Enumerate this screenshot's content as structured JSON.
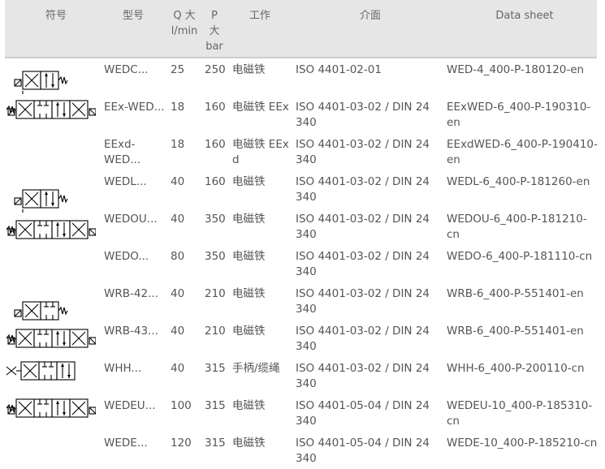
{
  "header": {
    "symbol": "符号",
    "model": "型号",
    "q_max": "Q 大 l/min",
    "p_max": "P 大 bar",
    "operation": "工作",
    "interface": "介面",
    "datasheet": "Data sheet"
  },
  "rows": [
    {
      "model": "WEDC...",
      "q": "25",
      "p": "250",
      "op": "电磁铁",
      "iface": "ISO 4401-02-01",
      "ds": "WED-4_400-P-180120-en",
      "symbol": "valve-3pos-single-solenoid-icon"
    },
    {
      "model": "EEx-WED...",
      "q": "18",
      "p": "160",
      "op": "电磁铁 EEx",
      "iface": "ISO 4401-03-02 / DIN 24 340",
      "ds": "EExWED-6_400-P-190310-en",
      "symbol": "valve-3pos-double-solenoid-icon"
    },
    {
      "model": "EExd-WED...",
      "q": "18",
      "p": "160",
      "op": "电磁铁 EEx d",
      "iface": "ISO 4401-03-02 / DIN 24 340",
      "ds": "EExdWED-6_400-P-190410-en",
      "symbol": ""
    },
    {
      "model": "WEDL...",
      "q": "40",
      "p": "160",
      "op": "电磁铁",
      "iface": "ISO 4401-03-02 / DIN 24 340",
      "ds": "WEDL-6_400-P-181260-en",
      "symbol": "valve-2pos-single-solenoid-icon"
    },
    {
      "model": "WEDOU...",
      "q": "40",
      "p": "350",
      "op": "电磁铁",
      "iface": "ISO 4401-03-02 / DIN 24 340",
      "ds": "WEDOU-6_400-P-181210-cn",
      "symbol": "valve-3pos-double-solenoid-icon"
    },
    {
      "model": "WEDO...",
      "q": "80",
      "p": "350",
      "op": "电磁铁",
      "iface": "ISO 4401-03-02 / DIN 24 340",
      "ds": "WEDO-6_400-P-181110-cn",
      "symbol": ""
    },
    {
      "model": "WRB-42...",
      "q": "40",
      "p": "210",
      "op": "电磁铁",
      "iface": "ISO 4401-03-02 / DIN 24 340",
      "ds": "WRB-6_400-P-551401-en",
      "symbol": "valve-2pos-spring-return-icon"
    },
    {
      "model": "WRB-43...",
      "q": "40",
      "p": "210",
      "op": "电磁铁",
      "iface": "ISO 4401-03-02 / DIN 24 340",
      "ds": "WRB-6_400-P-551401-en",
      "symbol": "valve-3pos-double-solenoid-icon"
    },
    {
      "model": "WHH...",
      "q": "40",
      "p": "315",
      "op": "手柄/缆绳",
      "iface": "ISO 4401-03-02 / DIN 24 340",
      "ds": "WHH-6_400-P-200110-cn",
      "symbol": "valve-manual-lever-icon"
    },
    {
      "model": "WEDEU...",
      "q": "100",
      "p": "315",
      "op": "电磁铁",
      "iface": "ISO 4401-05-04 / DIN 24 340",
      "ds": "WEDEU-10_400-P-185310-cn",
      "symbol": "valve-3pos-double-solenoid-icon"
    },
    {
      "model": "WEDE...",
      "q": "120",
      "p": "315",
      "op": "电磁铁",
      "iface": "ISO 4401-05-04 / DIN 24 340",
      "ds": "WEDE-10_400-P-185210-cn",
      "symbol": ""
    }
  ]
}
